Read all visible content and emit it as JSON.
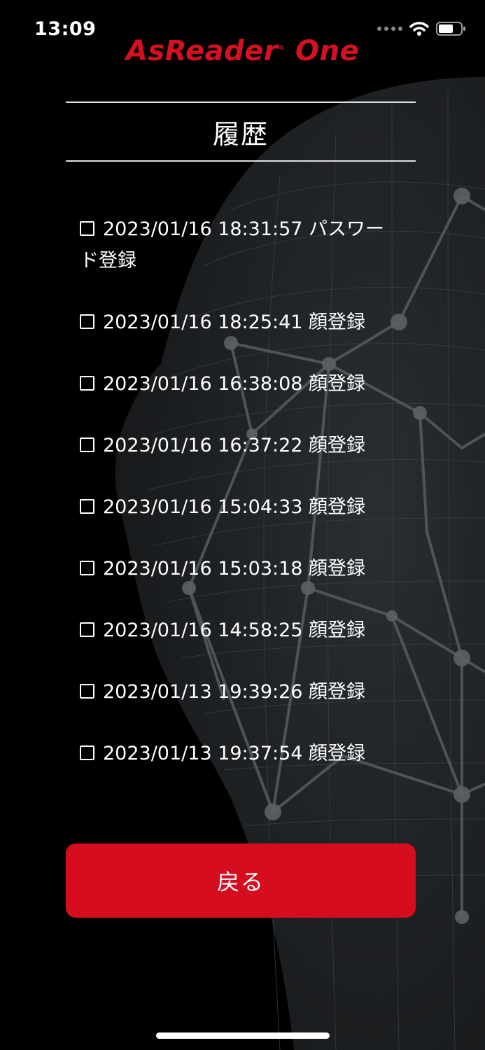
{
  "status_bar": {
    "time": "13:09"
  },
  "app": {
    "logo_text": "AsReader",
    "logo_suffix": "One",
    "logo_reg": "®"
  },
  "page": {
    "title": "履歴"
  },
  "history": {
    "items": [
      {
        "text": "2023/01/16 18:31:57 パスワード登録"
      },
      {
        "text": "2023/01/16 18:25:41 顔登録"
      },
      {
        "text": "2023/01/16 16:38:08 顔登録"
      },
      {
        "text": "2023/01/16 16:37:22 顔登録"
      },
      {
        "text": "2023/01/16 15:04:33 顔登録"
      },
      {
        "text": "2023/01/16 15:03:18 顔登録"
      },
      {
        "text": "2023/01/16 14:58:25 顔登録"
      },
      {
        "text": "2023/01/13 19:39:26 顔登録"
      },
      {
        "text": "2023/01/13 19:37:54 顔登録"
      }
    ]
  },
  "actions": {
    "back_label": "戻る"
  },
  "colors": {
    "accent": "#d60c1f",
    "background": "#000000",
    "face_bg": "#1c1f22"
  }
}
